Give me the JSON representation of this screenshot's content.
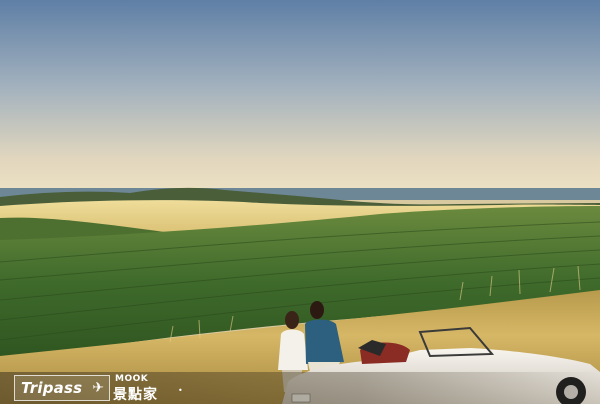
{
  "image": {
    "subject": "vineyard landscape",
    "colors": {
      "sky_top": "#6f8fb0",
      "sky_horizon": "#e9dcc0",
      "sea": "#5f7f95",
      "field_gold": "#e3cf86",
      "vines": "#3f6a2c",
      "grass": "#c9a85a",
      "car": "#ece7df"
    }
  },
  "watermark": {
    "brand": "Tripass",
    "icon": "airplane-icon",
    "mook": "MOOK",
    "site_cn": "景點家",
    "dot": "•"
  }
}
